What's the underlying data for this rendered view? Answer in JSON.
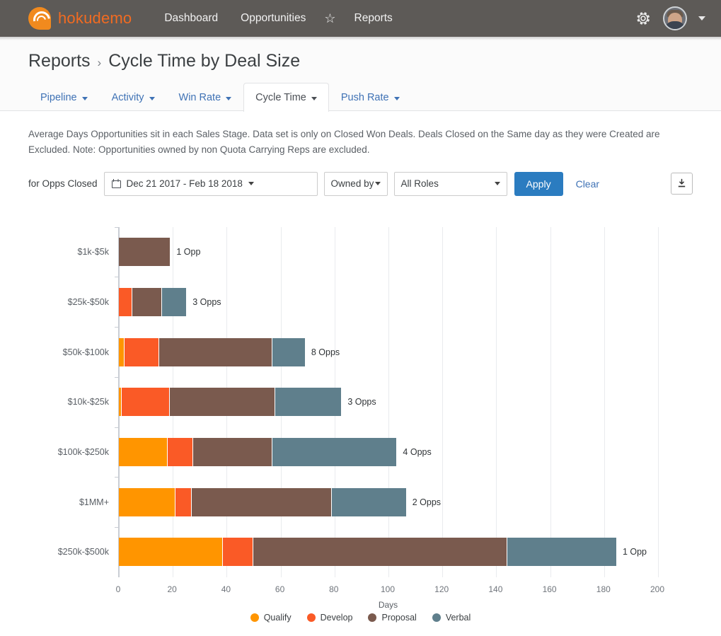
{
  "topnav": {
    "brand": "hokudemo",
    "links": [
      {
        "label": "Dashboard"
      },
      {
        "label": "Opportunities"
      },
      {
        "label": "Reports"
      }
    ],
    "star_icon": "☆",
    "gear_icon": "gear-icon",
    "avatar_caret": "▾"
  },
  "breadcrumb": {
    "parent": "Reports",
    "separator": "›",
    "current": "Cycle Time by Deal Size"
  },
  "tabs": [
    {
      "label": "Pipeline",
      "active": false
    },
    {
      "label": "Activity",
      "active": false
    },
    {
      "label": "Win Rate",
      "active": false
    },
    {
      "label": "Cycle Time",
      "active": true
    },
    {
      "label": "Push Rate",
      "active": false
    }
  ],
  "description": "Average Days Opportunities sit in each Sales Stage. Data set is only on Closed Won Deals. Deals Closed on the Same day as they were Created are Excluded. Note: Opportunities owned by non Quota Carrying Reps are excluded.",
  "filters": {
    "label": "for Opps Closed",
    "date_range": "Dec 21 2017 - Feb 18 2018",
    "owned_by": "Owned by",
    "role": "All Roles",
    "apply_label": "Apply",
    "clear_label": "Clear",
    "download_icon": "download-icon"
  },
  "colors": {
    "qualify": "#FF9500",
    "develop": "#FA5A26",
    "proposal": "#7A5A4E",
    "verbal": "#5F7F8C",
    "accent_blue": "#2b7cc0",
    "link_blue": "#3f72b5",
    "nav_bg": "#5d5a57",
    "brand_orange": "#f26b21"
  },
  "chart_data": {
    "type": "bar",
    "orientation": "horizontal",
    "stacked": true,
    "title": "",
    "xlabel": "Days",
    "ylabel": "",
    "xlim": [
      0,
      200
    ],
    "xticks": [
      0,
      20,
      40,
      60,
      80,
      100,
      120,
      140,
      160,
      180,
      200
    ],
    "grid": true,
    "legend_position": "bottom",
    "categories": [
      "$1k-$5k",
      "$25k-$50k",
      "$50k-$100k",
      "$10k-$25k",
      "$100k-$250k",
      "$1MM+",
      "$250k-$500k"
    ],
    "series": [
      {
        "name": "Qualify",
        "color": "#FF9500",
        "values": [
          0,
          0,
          2,
          1,
          18,
          21,
          38.7
        ]
      },
      {
        "name": "Develop",
        "color": "#FA5A26",
        "values": [
          0,
          5,
          13,
          18,
          9.5,
          6,
          11.3
        ]
      },
      {
        "name": "Proposal",
        "color": "#7A5A4E",
        "values": [
          19,
          11,
          42,
          39,
          29.5,
          52,
          94
        ]
      },
      {
        "name": "Verbal",
        "color": "#5F7F8C",
        "values": [
          0,
          9,
          12,
          24.5,
          46,
          27.5,
          40.5
        ]
      }
    ],
    "row_totals": [
      19,
      25,
      69,
      82.5,
      103,
      106.5,
      184.5
    ],
    "annotations": [
      {
        "category": "$1k-$5k",
        "text": "1 Opp",
        "count": 1
      },
      {
        "category": "$25k-$50k",
        "text": "3 Opps",
        "count": 3
      },
      {
        "category": "$50k-$100k",
        "text": "8 Opps",
        "count": 8
      },
      {
        "category": "$10k-$25k",
        "text": "3 Opps",
        "count": 3
      },
      {
        "category": "$100k-$250k",
        "text": "4 Opps",
        "count": 4
      },
      {
        "category": "$1MM+",
        "text": "2 Opps",
        "count": 2
      },
      {
        "category": "$250k-$500k",
        "text": "1 Opp",
        "count": 1
      }
    ]
  }
}
